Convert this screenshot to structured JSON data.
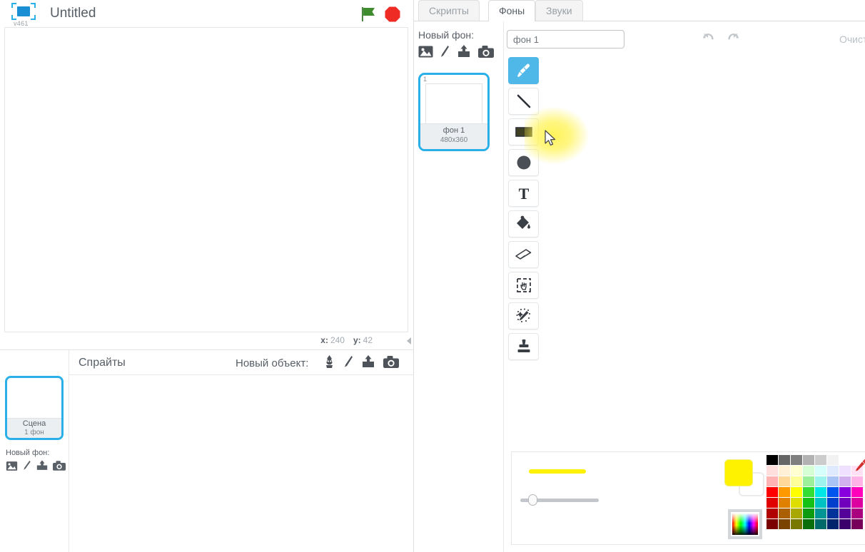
{
  "app": {
    "logo_version": "v461",
    "project_title": "Untitled",
    "logo_icon": "scratch-frame-logo",
    "green_flag_icon": "green-flag-icon",
    "stop_icon": "stop-sign-icon"
  },
  "stage": {
    "coord_x_label": "x:",
    "coord_x_value": "240",
    "coord_y_label": "y:",
    "coord_y_value": "42",
    "collapse_icon": "collapse-left-arrow-icon"
  },
  "sprite_pane": {
    "sprites_label": "Спрайты",
    "new_object_label": "Новый объект:",
    "new_object_icons": [
      "new-sprite-library-icon",
      "paint-new-sprite-icon",
      "upload-sprite-icon",
      "camera-sprite-icon"
    ],
    "stage_thumb": {
      "name": "Сцена",
      "count": "1 фон"
    },
    "new_backdrop_label": "Новый фон:",
    "new_backdrop_icons": [
      "backdrop-library-icon",
      "paint-new-backdrop-icon",
      "upload-backdrop-icon",
      "camera-backdrop-icon"
    ]
  },
  "tabs": [
    {
      "label": "Скрипты",
      "active": false
    },
    {
      "label": "Фоны",
      "active": true
    },
    {
      "label": "Звуки",
      "active": false
    }
  ],
  "backdrop_list": {
    "new_label": "Новый фон:",
    "new_icons": [
      "backdrop-library-icon",
      "paint-new-backdrop-icon",
      "upload-backdrop-icon",
      "camera-backdrop-icon"
    ],
    "items": [
      {
        "index": "1",
        "name": "фон 1",
        "size": "480x360",
        "selected": true
      }
    ]
  },
  "paint_editor": {
    "name_value": "фон 1",
    "name_placeholder": "фон 1",
    "undo_icon": "undo-arrow-icon",
    "redo_icon": "redo-arrow-icon",
    "clear_label": "Очистить",
    "tools": [
      {
        "name": "brush-tool",
        "label": "Кисть",
        "selected": true
      },
      {
        "name": "line-tool",
        "label": "Линия",
        "selected": false
      },
      {
        "name": "rectangle-tool",
        "label": "Прямоугольник",
        "selected": false
      },
      {
        "name": "ellipse-tool",
        "label": "Эллипс",
        "selected": false
      },
      {
        "name": "text-tool",
        "label": "Текст",
        "selected": false
      },
      {
        "name": "fill-tool",
        "label": "Заливка",
        "selected": false
      },
      {
        "name": "eraser-tool",
        "label": "Ластик",
        "selected": false
      },
      {
        "name": "select-tool",
        "label": "Выделение",
        "selected": false
      },
      {
        "name": "magic-wand-tool",
        "label": "Волшебная палочка",
        "selected": false
      },
      {
        "name": "stamp-tool",
        "label": "Штамп",
        "selected": false
      }
    ],
    "colors": {
      "foreground": "#FFF200",
      "background": "#FFFFFF",
      "brush_preview": "#FFF200",
      "brush_size_percent": 12
    },
    "palette_rows": [
      [
        "#000000",
        "#666666",
        "#7f7f7f",
        "#b2b2b2",
        "#cccccc",
        "#f2f2f2",
        "#ffffff",
        "#ffffff"
      ],
      [
        "#ffdede",
        "#fff0d6",
        "#ffffd1",
        "#d6ffd6",
        "#d6fffb",
        "#e0eaff",
        "#f0e0ff",
        "#ffe0f5"
      ],
      [
        "#ffb3b3",
        "#ffd89a",
        "#ffff99",
        "#9cf09c",
        "#9ef3ee",
        "#aac4f5",
        "#d2b0f0",
        "#ffb3e6"
      ],
      [
        "#ff0000",
        "#ff9900",
        "#ffff00",
        "#33dd33",
        "#00e5e5",
        "#0055ee",
        "#8800dd",
        "#ff00bb"
      ],
      [
        "#e00000",
        "#e08000",
        "#dede00",
        "#16c116",
        "#00c2c2",
        "#0040cc",
        "#7000bb",
        "#dd00a0"
      ],
      [
        "#b00000",
        "#aa6000",
        "#a8a800",
        "#0f9b0f",
        "#009595",
        "#003399",
        "#550099",
        "#aa0080"
      ],
      [
        "#7a0000",
        "#7a4400",
        "#787800",
        "#0a6f0a",
        "#006a6a",
        "#00246b",
        "#3b006b",
        "#77005a"
      ]
    ],
    "eyedropper_icon": "eyedropper-icon",
    "spectrum_icon": "color-spectrum-picker"
  }
}
